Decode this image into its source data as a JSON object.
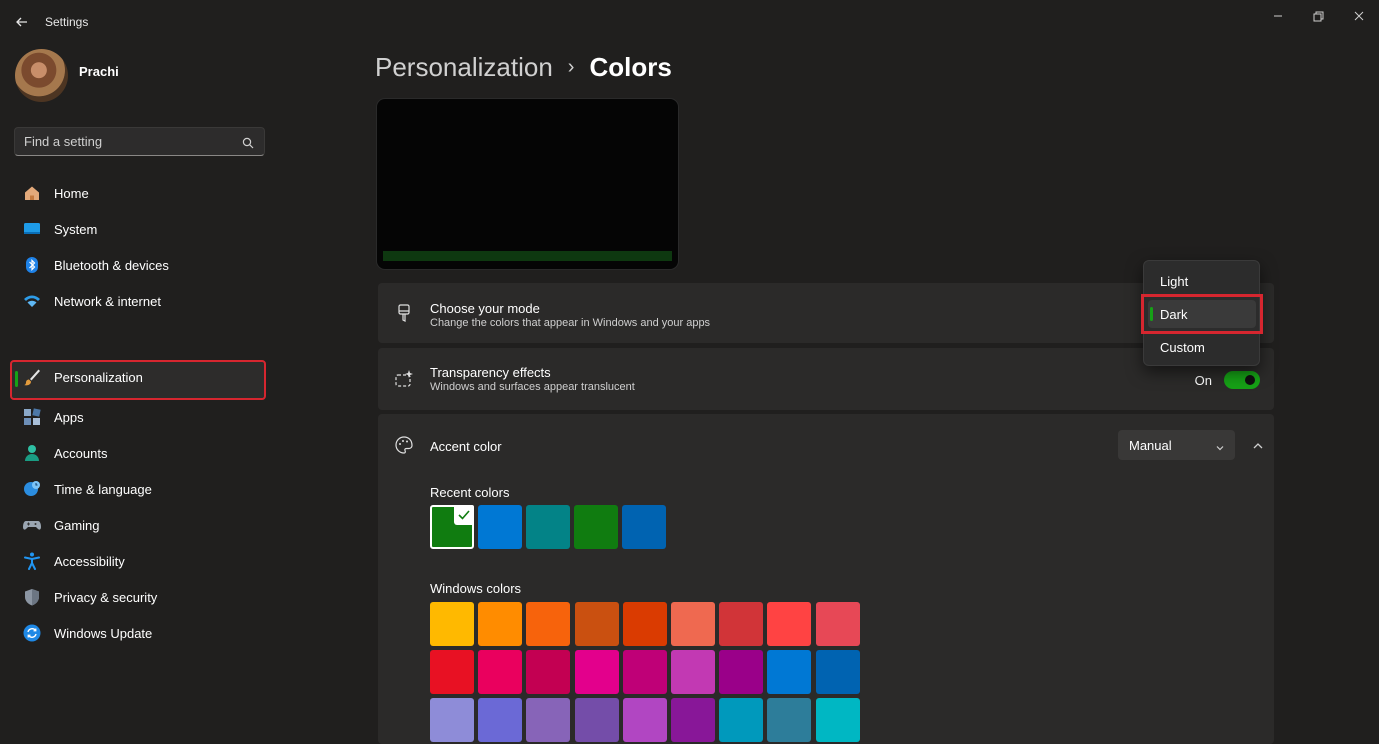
{
  "window": {
    "title": "Settings"
  },
  "user": {
    "name": "Prachi"
  },
  "search": {
    "placeholder": "Find a setting"
  },
  "sidebar": {
    "items": [
      {
        "label": "Home",
        "icon": "home-icon"
      },
      {
        "label": "System",
        "icon": "system-icon"
      },
      {
        "label": "Bluetooth & devices",
        "icon": "bluetooth-icon"
      },
      {
        "label": "Network & internet",
        "icon": "network-icon"
      },
      {
        "label": "Personalization",
        "icon": "paintbrush-icon",
        "selected": true
      },
      {
        "label": "Apps",
        "icon": "apps-icon"
      },
      {
        "label": "Accounts",
        "icon": "accounts-icon"
      },
      {
        "label": "Time & language",
        "icon": "globe-clock-icon"
      },
      {
        "label": "Gaming",
        "icon": "gamepad-icon"
      },
      {
        "label": "Accessibility",
        "icon": "accessibility-icon"
      },
      {
        "label": "Privacy & security",
        "icon": "shield-icon"
      },
      {
        "label": "Windows Update",
        "icon": "update-icon"
      }
    ]
  },
  "breadcrumb": {
    "parent": "Personalization",
    "separator": "›",
    "current": "Colors"
  },
  "mode": {
    "title": "Choose your mode",
    "description": "Change the colors that appear in Windows and your apps",
    "options": [
      "Light",
      "Dark",
      "Custom"
    ],
    "selected": "Dark"
  },
  "transparency": {
    "title": "Transparency effects",
    "description": "Windows and surfaces appear translucent",
    "state_label": "On"
  },
  "accent": {
    "title": "Accent color",
    "dropdown_value": "Manual",
    "recent_label": "Recent colors",
    "recent_colors": [
      "#107c10",
      "#0078d4",
      "#038387",
      "#107c10",
      "#0063b1"
    ],
    "windows_label": "Windows colors",
    "windows_colors": [
      [
        "#ffb900",
        "#ff8c00",
        "#f7630c",
        "#ca5010",
        "#da3b01",
        "#ef6950",
        "#d13438",
        "#ff4343",
        "#e74856"
      ],
      [
        "#e81123",
        "#ea005e",
        "#c30052",
        "#e3008c",
        "#bf0077",
        "#c239b3",
        "#9a0089",
        "#0078d4",
        "#0063b1"
      ],
      [
        "#8e8cd8",
        "#6b69d6",
        "#8764b8",
        "#744da9",
        "#b146c2",
        "#881798",
        "#0099bc",
        "#2d7d9a",
        "#00b7c3"
      ]
    ]
  },
  "colors": {
    "accent": "#16a116",
    "highlight": "#d6262f",
    "background": "#201f1e"
  }
}
